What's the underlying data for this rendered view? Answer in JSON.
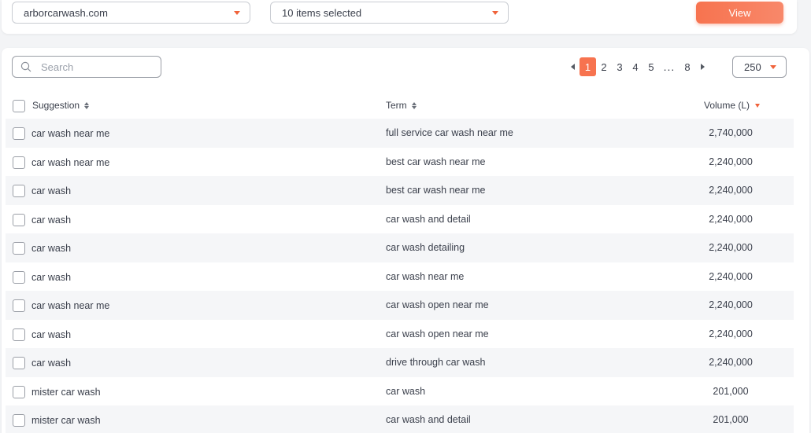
{
  "filters": {
    "domain": "arborcarwash.com",
    "items": "10 items selected",
    "view_label": "View"
  },
  "search": {
    "placeholder": "Search"
  },
  "pagination": {
    "pages_before": [
      "1",
      "2",
      "3",
      "4",
      "5"
    ],
    "current": "1",
    "ellipsis": "...",
    "last": "8",
    "per_page": "250"
  },
  "table": {
    "columns": {
      "suggestion": "Suggestion",
      "term": "Term",
      "volume": "Volume (L)"
    },
    "rows": [
      {
        "suggestion": "car wash near me",
        "term": "full service car wash near me",
        "volume": "2,740,000"
      },
      {
        "suggestion": "car wash near me",
        "term": "best car wash near me",
        "volume": "2,240,000"
      },
      {
        "suggestion": "car wash",
        "term": "best car wash near me",
        "volume": "2,240,000"
      },
      {
        "suggestion": "car wash",
        "term": "car wash and detail",
        "volume": "2,240,000"
      },
      {
        "suggestion": "car wash",
        "term": "car wash detailing",
        "volume": "2,240,000"
      },
      {
        "suggestion": "car wash",
        "term": "car wash near me",
        "volume": "2,240,000"
      },
      {
        "suggestion": "car wash near me",
        "term": "car wash open near me",
        "volume": "2,240,000"
      },
      {
        "suggestion": "car wash",
        "term": "car wash open near me",
        "volume": "2,240,000"
      },
      {
        "suggestion": "car wash",
        "term": "drive through car wash",
        "volume": "2,240,000"
      },
      {
        "suggestion": "mister car wash",
        "term": "car wash",
        "volume": "201,000"
      },
      {
        "suggestion": "mister car wash",
        "term": "car wash and detail",
        "volume": "201,000"
      }
    ]
  },
  "colors": {
    "accent": "#f7734f",
    "row_alt": "#f5f6f8",
    "page_bg": "#f3f4f6"
  }
}
